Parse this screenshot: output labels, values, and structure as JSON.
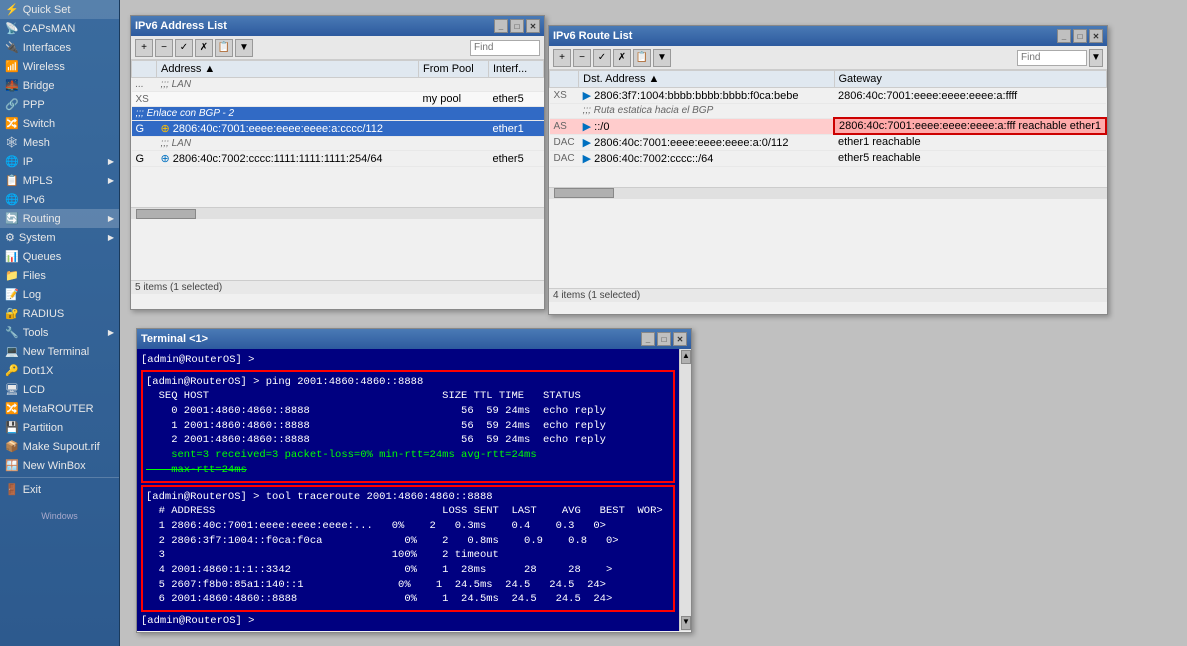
{
  "sidebar": {
    "items": [
      {
        "id": "quick-set",
        "label": "Quick Set",
        "icon": "⚡"
      },
      {
        "id": "capsman",
        "label": "CAPsMAN",
        "icon": "📡"
      },
      {
        "id": "interfaces",
        "label": "Interfaces",
        "icon": "🔌"
      },
      {
        "id": "wireless",
        "label": "Wireless",
        "icon": "📶"
      },
      {
        "id": "bridge",
        "label": "Bridge",
        "icon": "🌉"
      },
      {
        "id": "ppp",
        "label": "PPP",
        "icon": "🔗"
      },
      {
        "id": "switch",
        "label": "Switch",
        "icon": "🔀"
      },
      {
        "id": "mesh",
        "label": "Mesh",
        "icon": "🕸"
      },
      {
        "id": "ip",
        "label": "IP",
        "icon": "🌐",
        "has_arrow": true
      },
      {
        "id": "mpls",
        "label": "MPLS",
        "icon": "📋",
        "has_arrow": true
      },
      {
        "id": "ipv6",
        "label": "IPv6",
        "icon": "🌐"
      },
      {
        "id": "routing",
        "label": "Routing",
        "icon": "🔄",
        "has_arrow": true
      },
      {
        "id": "system",
        "label": "System",
        "icon": "⚙",
        "has_arrow": true
      },
      {
        "id": "queues",
        "label": "Queues",
        "icon": "📊"
      },
      {
        "id": "files",
        "label": "Files",
        "icon": "📁"
      },
      {
        "id": "log",
        "label": "Log",
        "icon": "📝"
      },
      {
        "id": "radius",
        "label": "RADIUS",
        "icon": "🔐"
      },
      {
        "id": "tools",
        "label": "Tools",
        "icon": "🔧",
        "has_arrow": true
      },
      {
        "id": "new-terminal",
        "label": "New Terminal",
        "icon": "💻"
      },
      {
        "id": "dot1x",
        "label": "Dot1X",
        "icon": "🔑"
      },
      {
        "id": "lcd",
        "label": "LCD",
        "icon": "🖥"
      },
      {
        "id": "metarouter",
        "label": "MetaROUTER",
        "icon": "🔀"
      },
      {
        "id": "partition",
        "label": "Partition",
        "icon": "💾"
      },
      {
        "id": "make-supout",
        "label": "Make Supout.rif",
        "icon": "📦"
      },
      {
        "id": "new-winbox",
        "label": "New WinBox",
        "icon": "🪟"
      },
      {
        "id": "exit",
        "label": "Exit",
        "icon": "🚪"
      }
    ]
  },
  "ipv6_address_list": {
    "title": "IPv6 Address List",
    "toolbar_buttons": [
      "+",
      "-",
      "✓",
      "✗",
      "📋",
      "🔽"
    ],
    "search_placeholder": "Find",
    "columns": [
      "Address",
      "From Pool",
      "Interface"
    ],
    "rows": [
      {
        "flags": "...",
        "type": "section",
        "label": "LAN"
      },
      {
        "flags": "XS",
        "label": ""
      },
      {
        "flags": "",
        "type": "section2",
        "label": ";;; Enlace con BGP - 2",
        "selected": true
      },
      {
        "flags": "G",
        "address": "2806:40c:7001:eeee:eeee:eeee:a:cccc/112",
        "from_pool": "",
        "interface": "ether1",
        "selected": true,
        "icon": "🟡"
      },
      {
        "flags": "",
        "type": "section2",
        "label": ";;; LAN"
      },
      {
        "flags": "G",
        "address": "2806:40c:7002:cccc:1111:1111:1111:254/64",
        "from_pool": "",
        "interface": "ether5",
        "icon": "🔵"
      }
    ],
    "status": "5 items (1 selected)"
  },
  "ipv6_route_list": {
    "title": "IPv6 Route List",
    "toolbar_buttons": [
      "+",
      "-",
      "✓",
      "✗",
      "📋",
      "🔽"
    ],
    "search_placeholder": "Find",
    "columns": [
      "Dst. Address",
      "Gateway"
    ],
    "rows": [
      {
        "flags": "XS",
        "dst": "2806:3f7:1004:bbbb:bbbb:bbbb:f0ca:bebe",
        "gateway": "2806:40c:7001:eeee:eeee:eeee:a:ffff"
      },
      {
        "flags": "",
        "type": "section",
        "label": ";;; Ruta estatica hacia el BGP"
      },
      {
        "flags": "AS",
        "dst": "::/0",
        "gateway": "2806:40c:7001:eeee:eeee:eeee:a:fff reachable ether1",
        "highlight": true
      },
      {
        "flags": "DAC",
        "dst": "2806:40c:7001:eeee:eeee:eeee:a:0/112",
        "gateway": "ether1 reachable"
      },
      {
        "flags": "DAC",
        "dst": "2806:40c:7002:cccc::/64",
        "gateway": "ether5 reachable"
      }
    ],
    "status": "4 items (1 selected)"
  },
  "terminal": {
    "title": "Terminal <1>",
    "initial_line": "[admin@RouterOS] >",
    "ping_section": {
      "cmd": "[admin@RouterOS] > ping 2001:4860:4860::8888",
      "header": "  SEQ HOST                                     SIZE TTL TIME   STATUS",
      "rows": [
        "    0 2001:4860:4860::8888                        56  59 24ms  echo reply",
        "    1 2001:4860:4860::8888                        56  59 24ms  echo reply",
        "    2 2001:4860:4860::8888                        56  59 24ms  echo reply"
      ],
      "stat": "    sent=3 received=3 packet-loss=0% min-rtt=24ms avg-rtt=24ms",
      "stat2": "    max-rtt=24ms"
    },
    "traceroute_section": {
      "cmd": "[admin@RouterOS] > tool traceroute 2001:4860:4860::8888",
      "header": "  # ADDRESS                                    LOSS SENT  LAST    AVG   BEST  WOR>",
      "rows": [
        "  1 2806:40c:7001:eeee:eeee:eeee:...   0%    2   0.3ms    0.4    0.3   0>",
        "  2 2806:3f7:1004::f0ca:f0ca             0%    2   0.8ms    0.9    0.8   0>",
        "  3                                    100%    2 timeout",
        "  4 2001:4860:1:1::3342                  0%    1  28ms      28     28    >",
        "  5 2607:f8b0:85a1:140::1               0%    1  24.5ms  24.5   24.5  24>",
        "  6 2001:4860:4860::8888                 0%    1  24.5ms  24.5   24.5  24>"
      ]
    },
    "prompt": "[admin@RouterOS] > "
  },
  "colors": {
    "titlebar_start": "#4a7ab5",
    "titlebar_end": "#2d5a9e",
    "selected_row": "#316ac5",
    "highlight_row": "#ffaaaa",
    "terminal_bg": "#000080",
    "terminal_fg": "#ffffff",
    "section_red_border": "#ff0000",
    "sidebar_bg": "#3a6b9e"
  }
}
